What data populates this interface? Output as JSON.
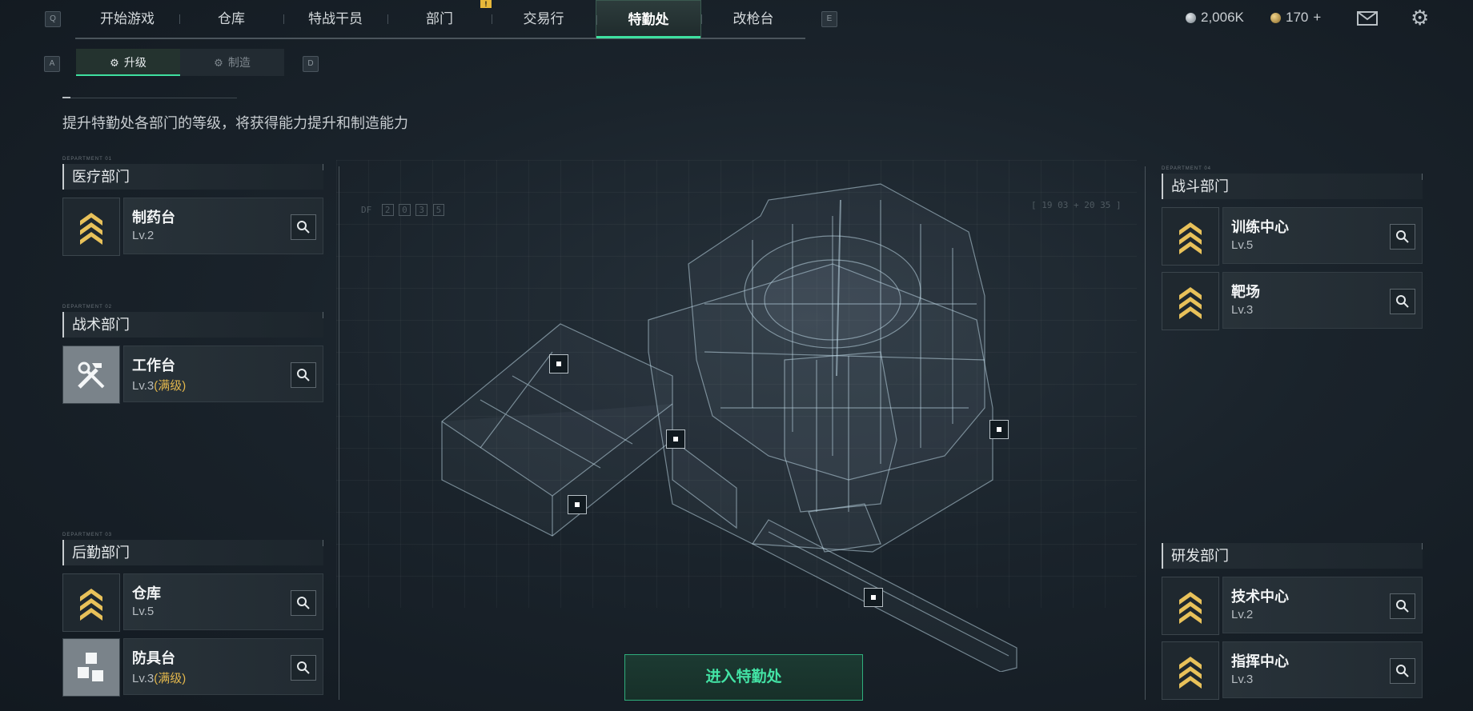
{
  "nav": {
    "key_left": "Q",
    "key_right": "E",
    "tabs": [
      "开始游戏",
      "仓库",
      "特战干员",
      "部门",
      "交易行",
      "特勤处",
      "改枪台"
    ],
    "active_tab": "特勤处",
    "alert_badge": "!"
  },
  "currency": {
    "silver": "2,006K",
    "gold": "170",
    "gold_add": "+"
  },
  "subnav": {
    "key_left": "A",
    "key_right": "D",
    "upgrade_label": "升级",
    "craft_label": "制造"
  },
  "description": "提升特勤处各部门的等级，将获得能力提升和制造能力",
  "departments": [
    {
      "tag": "DEPARTMENT 01",
      "name": "医疗部门",
      "facilities": [
        {
          "name": "制药台",
          "level": "Lv.2",
          "max": ""
        }
      ]
    },
    {
      "tag": "DEPARTMENT 02",
      "name": "战术部门",
      "facilities": [
        {
          "name": "工作台",
          "level": "Lv.3",
          "max": "(满级)"
        }
      ]
    },
    {
      "tag": "DEPARTMENT 03",
      "name": "后勤部门",
      "facilities": [
        {
          "name": "仓库",
          "level": "Lv.5",
          "max": ""
        },
        {
          "name": "防具台",
          "level": "Lv.3",
          "max": "(满级)"
        }
      ]
    },
    {
      "tag": "DEPARTMENT 04",
      "name": "战斗部门",
      "facilities": [
        {
          "name": "训练中心",
          "level": "Lv.5",
          "max": ""
        },
        {
          "name": "靶场",
          "level": "Lv.3",
          "max": ""
        }
      ]
    },
    {
      "tag": "",
      "name": "研发部门",
      "facilities": [
        {
          "name": "技术中心",
          "level": "Lv.2",
          "max": ""
        },
        {
          "name": "指挥中心",
          "level": "Lv.3",
          "max": ""
        }
      ]
    }
  ],
  "hud": {
    "df_label": "DF",
    "df_digits": [
      "2",
      "0",
      "3",
      "5"
    ],
    "coords": "[ 19 03 + 20 35 ]"
  },
  "enter_button": "进入特勤处",
  "colors": {
    "accent": "#3ee0a0",
    "gold": "#e1b64c",
    "bg": "#1a232b"
  }
}
